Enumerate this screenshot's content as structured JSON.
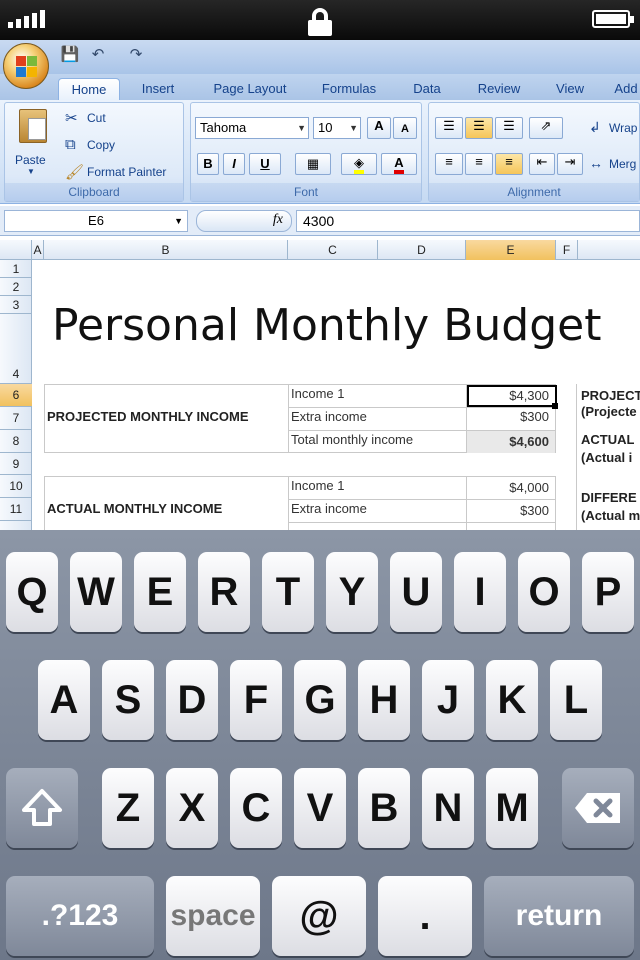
{
  "status_bar": {
    "signal_bars": 5,
    "lock_icon": "lock-icon",
    "battery_level": 1.0
  },
  "excel": {
    "quick_access": {
      "save_icon": "save-icon",
      "undo_icon": "undo-icon",
      "redo_icon": "redo-icon"
    },
    "tabs": [
      "Home",
      "Insert",
      "Page Layout",
      "Formulas",
      "Data",
      "Review",
      "View",
      "Add"
    ],
    "active_tab": "Home",
    "clipboard": {
      "paste": "Paste",
      "cut": "Cut",
      "copy": "Copy",
      "format_painter": "Format Painter",
      "label": "Clipboard"
    },
    "font": {
      "family": "Tahoma",
      "size": "10",
      "bold": "B",
      "italic": "I",
      "underline": "U",
      "grow": "A",
      "shrink": "A",
      "font_color": "A",
      "label": "Font"
    },
    "alignment": {
      "wrap": "Wrap",
      "merge": "Merg",
      "label": "Alignment"
    },
    "name_box": "E6",
    "fx_label": "fx",
    "formula_value": "4300",
    "columns": [
      "A",
      "B",
      "C",
      "D",
      "E",
      "F"
    ],
    "selected_column": "E",
    "rows": [
      "1",
      "2",
      "3",
      "4",
      "6",
      "7",
      "8",
      "9",
      "10",
      "11"
    ],
    "selected_row": "6",
    "sheet_title": "Personal Monthly Budget",
    "projected": {
      "label": "PROJECTED MONTHLY INCOME",
      "rows": [
        {
          "name": "Income 1",
          "value": "$4,300"
        },
        {
          "name": "Extra income",
          "value": "$300"
        },
        {
          "name": "Total monthly income",
          "value": "$4,600"
        }
      ]
    },
    "actual": {
      "label": "ACTUAL MONTHLY INCOME",
      "rows": [
        {
          "name": "Income 1",
          "value": "$4,000"
        },
        {
          "name": "Extra income",
          "value": "$300"
        }
      ]
    },
    "side_labels": {
      "projected_1": "PROJECTE",
      "projected_2": "(Projecte",
      "actual_1": "ACTUAL",
      "actual_2": "(Actual i",
      "diff_1": "DIFFERE",
      "diff_2": "(Actual m"
    }
  },
  "keyboard": {
    "row1": [
      "Q",
      "W",
      "E",
      "R",
      "T",
      "Y",
      "U",
      "I",
      "O",
      "P"
    ],
    "row2": [
      "A",
      "S",
      "D",
      "F",
      "G",
      "H",
      "J",
      "K",
      "L"
    ],
    "row3": [
      "Z",
      "X",
      "C",
      "V",
      "B",
      "N",
      "M"
    ],
    "numbers_key": ".?123",
    "space_key": "space",
    "at_key": "@",
    "dot_key": ".",
    "return_key": "return",
    "shift_icon": "shift-icon",
    "backspace_icon": "backspace-icon"
  }
}
